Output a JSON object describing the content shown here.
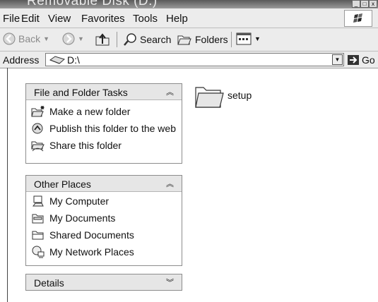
{
  "window": {
    "title": "Removable Disk (D:)"
  },
  "menubar": {
    "items": [
      "File",
      "Edit",
      "View",
      "Favorites",
      "Tools",
      "Help"
    ]
  },
  "toolbar": {
    "back": "Back",
    "search": "Search",
    "folders": "Folders"
  },
  "address": {
    "label": "Address",
    "value": "D:\\",
    "go": "Go"
  },
  "tasks_panel": {
    "title": "File and Folder Tasks",
    "items": [
      "Make a new folder",
      "Publish this folder to the web",
      "Share this folder"
    ]
  },
  "places_panel": {
    "title": "Other Places",
    "items": [
      "My Computer",
      "My Documents",
      "Shared Documents",
      "My Network Places"
    ]
  },
  "details_panel": {
    "title": "Details"
  },
  "content": {
    "items": [
      {
        "name": "setup",
        "icon": "folder-icon"
      }
    ]
  }
}
